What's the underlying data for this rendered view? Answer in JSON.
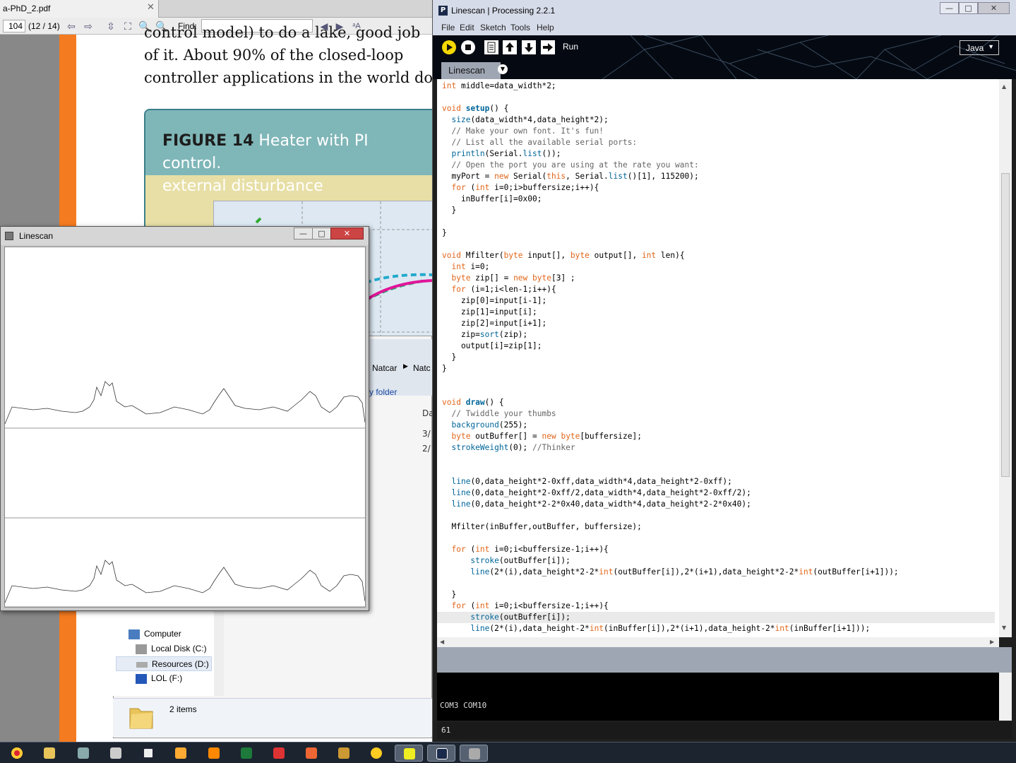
{
  "pdf": {
    "tab_title": "a-PhD_2.pdf",
    "page_input": "104",
    "page_count": "(12 / 14)",
    "find_label": "Find:",
    "find_value": "",
    "body_lines": [
      "control model) to do a lake, good job",
      "of it. About 90% of the closed-loop",
      "controller applications in the world do"
    ],
    "figure_label": "FIGURE 14",
    "figure_caption_1": "Heater with PI control.",
    "figure_caption_2": "external disturbance"
  },
  "explorer": {
    "crumb_a": "Natcar",
    "crumb_b": "Natc",
    "folder_link": "y folder",
    "col_header": "Da",
    "date1": "3/",
    "date2": "2/",
    "nav": [
      "Computer",
      "Local Disk (C:)",
      "Resources (D:)",
      "LOL (F:)"
    ],
    "status": "2 items"
  },
  "linescan_window": {
    "title": "Linescan",
    "min": "—",
    "max": "□",
    "close": "✕",
    "traces": [
      {
        "name": "filtered",
        "baseline": "upper"
      },
      {
        "name": "raw",
        "baseline": "lower"
      }
    ]
  },
  "ide": {
    "title": "Linescan | Processing 2.2.1",
    "logo": "P",
    "menus": [
      "File",
      "Edit",
      "Sketch",
      "Tools",
      "Help"
    ],
    "run_label": "Run",
    "mode": "Java",
    "tab": "Linescan",
    "console_text": "COM3 COM10",
    "status_line": "61",
    "toolbar_icons": [
      "run-icon",
      "stop-icon",
      "new-icon",
      "open-icon",
      "save-icon",
      "export-icon"
    ]
  },
  "taskbar": {
    "items": [
      "chrome",
      "folder",
      "monitor",
      "calculator",
      "search",
      "pen",
      "wolfram",
      "excel",
      "paint",
      "matlab",
      "archive",
      "python",
      "pdf",
      "processing",
      "window"
    ]
  }
}
